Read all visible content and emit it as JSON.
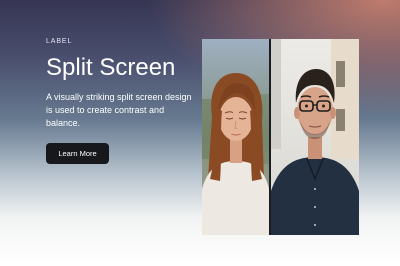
{
  "hero": {
    "label": "LABEL",
    "title": "Split Screen",
    "description": "A visually striking split screen design is used to create contrast and balance.",
    "cta_label": "Learn More"
  },
  "split": {
    "left_image": "portrait-woman-eyes-closed",
    "right_image": "portrait-man-glasses"
  },
  "colors": {
    "button_bg": "#17181c",
    "bg_top": "#353553",
    "accent_glow": "#c7806e"
  }
}
